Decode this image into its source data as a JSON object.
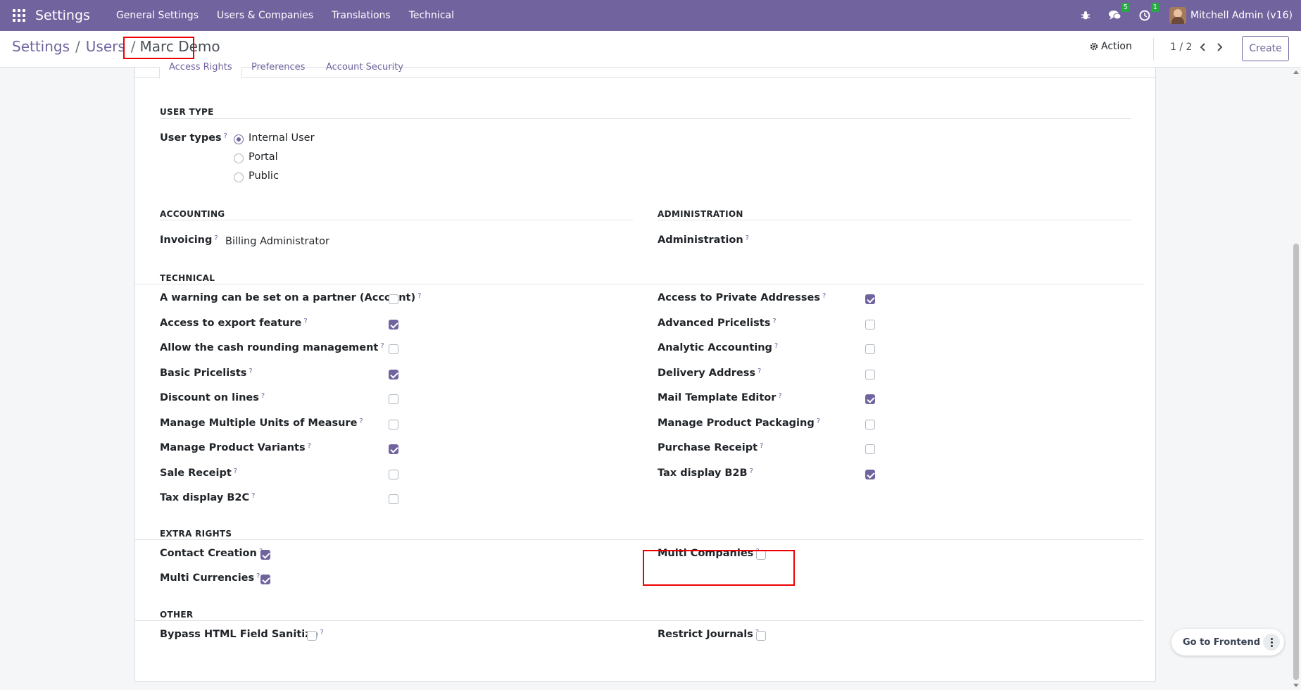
{
  "navbar": {
    "brand": "Settings",
    "menu": [
      "General Settings",
      "Users & Companies",
      "Translations",
      "Technical"
    ],
    "messages_badge": "5",
    "activities_badge": "1",
    "user": "Mitchell Admin (v16)"
  },
  "breadcrumb": {
    "root": "Settings",
    "parent": "Users",
    "separator": "/",
    "current": "Marc Demo"
  },
  "control": {
    "action_label": "Action",
    "pager": "1 / 2",
    "create_label": "Create"
  },
  "tabs": [
    "Access Rights",
    "Preferences",
    "Account Security"
  ],
  "user_type": {
    "title": "USER TYPE",
    "label": "User types",
    "options": [
      {
        "label": "Internal User",
        "selected": true
      },
      {
        "label": "Portal",
        "selected": false
      },
      {
        "label": "Public",
        "selected": false
      }
    ]
  },
  "accounting": {
    "title": "ACCOUNTING",
    "label": "Invoicing",
    "value": "Billing Administrator"
  },
  "administration": {
    "title": "ADMINISTRATION",
    "label": "Administration",
    "value": ""
  },
  "technical": {
    "title": "TECHNICAL",
    "left": [
      {
        "label": "A warning can be set on a partner (Account)",
        "checked": false
      },
      {
        "label": "Access to export feature",
        "checked": true
      },
      {
        "label": "Allow the cash rounding management",
        "checked": false
      },
      {
        "label": "Basic Pricelists",
        "checked": true
      },
      {
        "label": "Discount on lines",
        "checked": false
      },
      {
        "label": "Manage Multiple Units of Measure",
        "checked": false
      },
      {
        "label": "Manage Product Variants",
        "checked": true
      },
      {
        "label": "Sale Receipt",
        "checked": false
      },
      {
        "label": "Tax display B2C",
        "checked": false
      }
    ],
    "right": [
      {
        "label": "Access to Private Addresses",
        "checked": true
      },
      {
        "label": "Advanced Pricelists",
        "checked": false
      },
      {
        "label": "Analytic Accounting",
        "checked": false
      },
      {
        "label": "Delivery Address",
        "checked": false
      },
      {
        "label": "Mail Template Editor",
        "checked": true
      },
      {
        "label": "Manage Product Packaging",
        "checked": false
      },
      {
        "label": "Purchase Receipt",
        "checked": false
      },
      {
        "label": "Tax display B2B",
        "checked": true
      }
    ]
  },
  "extra_rights": {
    "title": "EXTRA RIGHTS",
    "items": [
      {
        "label": "Contact Creation",
        "checked": true
      },
      {
        "label": "Multi Currencies",
        "checked": true
      },
      {
        "label": "Multi Companies",
        "checked": false
      }
    ]
  },
  "other": {
    "title": "OTHER",
    "items": [
      {
        "label": "Bypass HTML Field Sanitize",
        "checked": false
      },
      {
        "label": "Restrict Journals",
        "checked": false
      }
    ]
  },
  "help_marker": "?",
  "frontend_button": "Go to Frontend",
  "colors": {
    "brand": "#71639e",
    "highlight": "#ee0000",
    "badge": "#28a745"
  }
}
